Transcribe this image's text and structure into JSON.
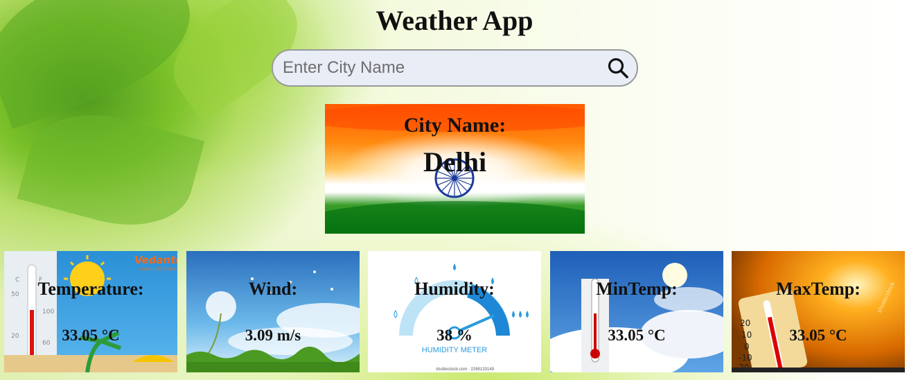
{
  "header": {
    "title": "Weather App"
  },
  "search": {
    "placeholder": "Enter City Name",
    "value": ""
  },
  "city": {
    "label": "City Name:",
    "value": "Delhi"
  },
  "cards": [
    {
      "label": "Temperature:",
      "value": "33.05 °C",
      "image_text": "Vedantu",
      "image_subtext": "Learn LIVE Online"
    },
    {
      "label": "Wind:",
      "value": "3.09 m/s"
    },
    {
      "label": "Humidity:",
      "value": "38 %",
      "image_text": "HUMIDITY METER",
      "image_subtext": "shutterstock.com · 2265133149"
    },
    {
      "label": "MinTemp:",
      "value": "33.05 °C"
    },
    {
      "label": "MaxTemp:",
      "value": "33.05 °C",
      "image_subtext": "shutterstock"
    }
  ],
  "icons": {
    "search": "search-icon",
    "chakra": "ashoka-chakra-icon"
  }
}
